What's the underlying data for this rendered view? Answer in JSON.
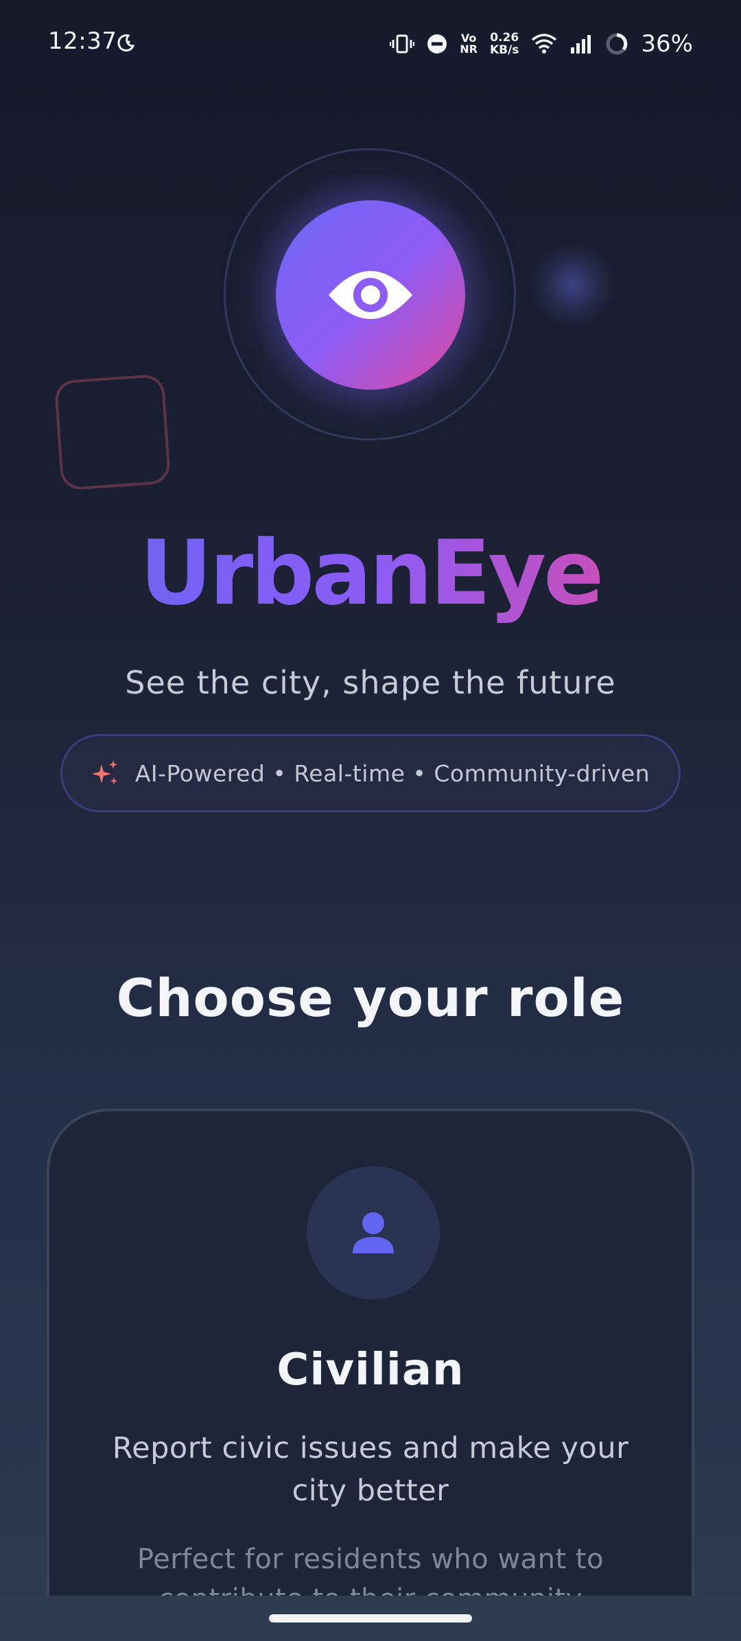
{
  "status_bar": {
    "time": "12:37",
    "volte_top": "Vo",
    "volte_bottom": "NR",
    "net_speed_value": "0.26",
    "net_speed_unit": "KB/s",
    "battery": "36%"
  },
  "brand": {
    "name": "UrbanEye",
    "tagline": "See the city, shape the future",
    "features": "AI-Powered • Real-time • Community-driven"
  },
  "section": {
    "heading": "Choose your role"
  },
  "role_card": {
    "title": "Civilian",
    "description": "Report civic issues and make your city better",
    "subtext": "Perfect for residents who want to contribute to their community"
  },
  "colors": {
    "accent_start": "#6366f1",
    "accent_mid": "#8b5cf6",
    "accent_end": "#ec4899",
    "sparkle": "#f87171",
    "background": "#1b2133"
  },
  "icons": {
    "logo": "eye-icon",
    "features": "sparkles-icon",
    "role": "person-icon"
  }
}
